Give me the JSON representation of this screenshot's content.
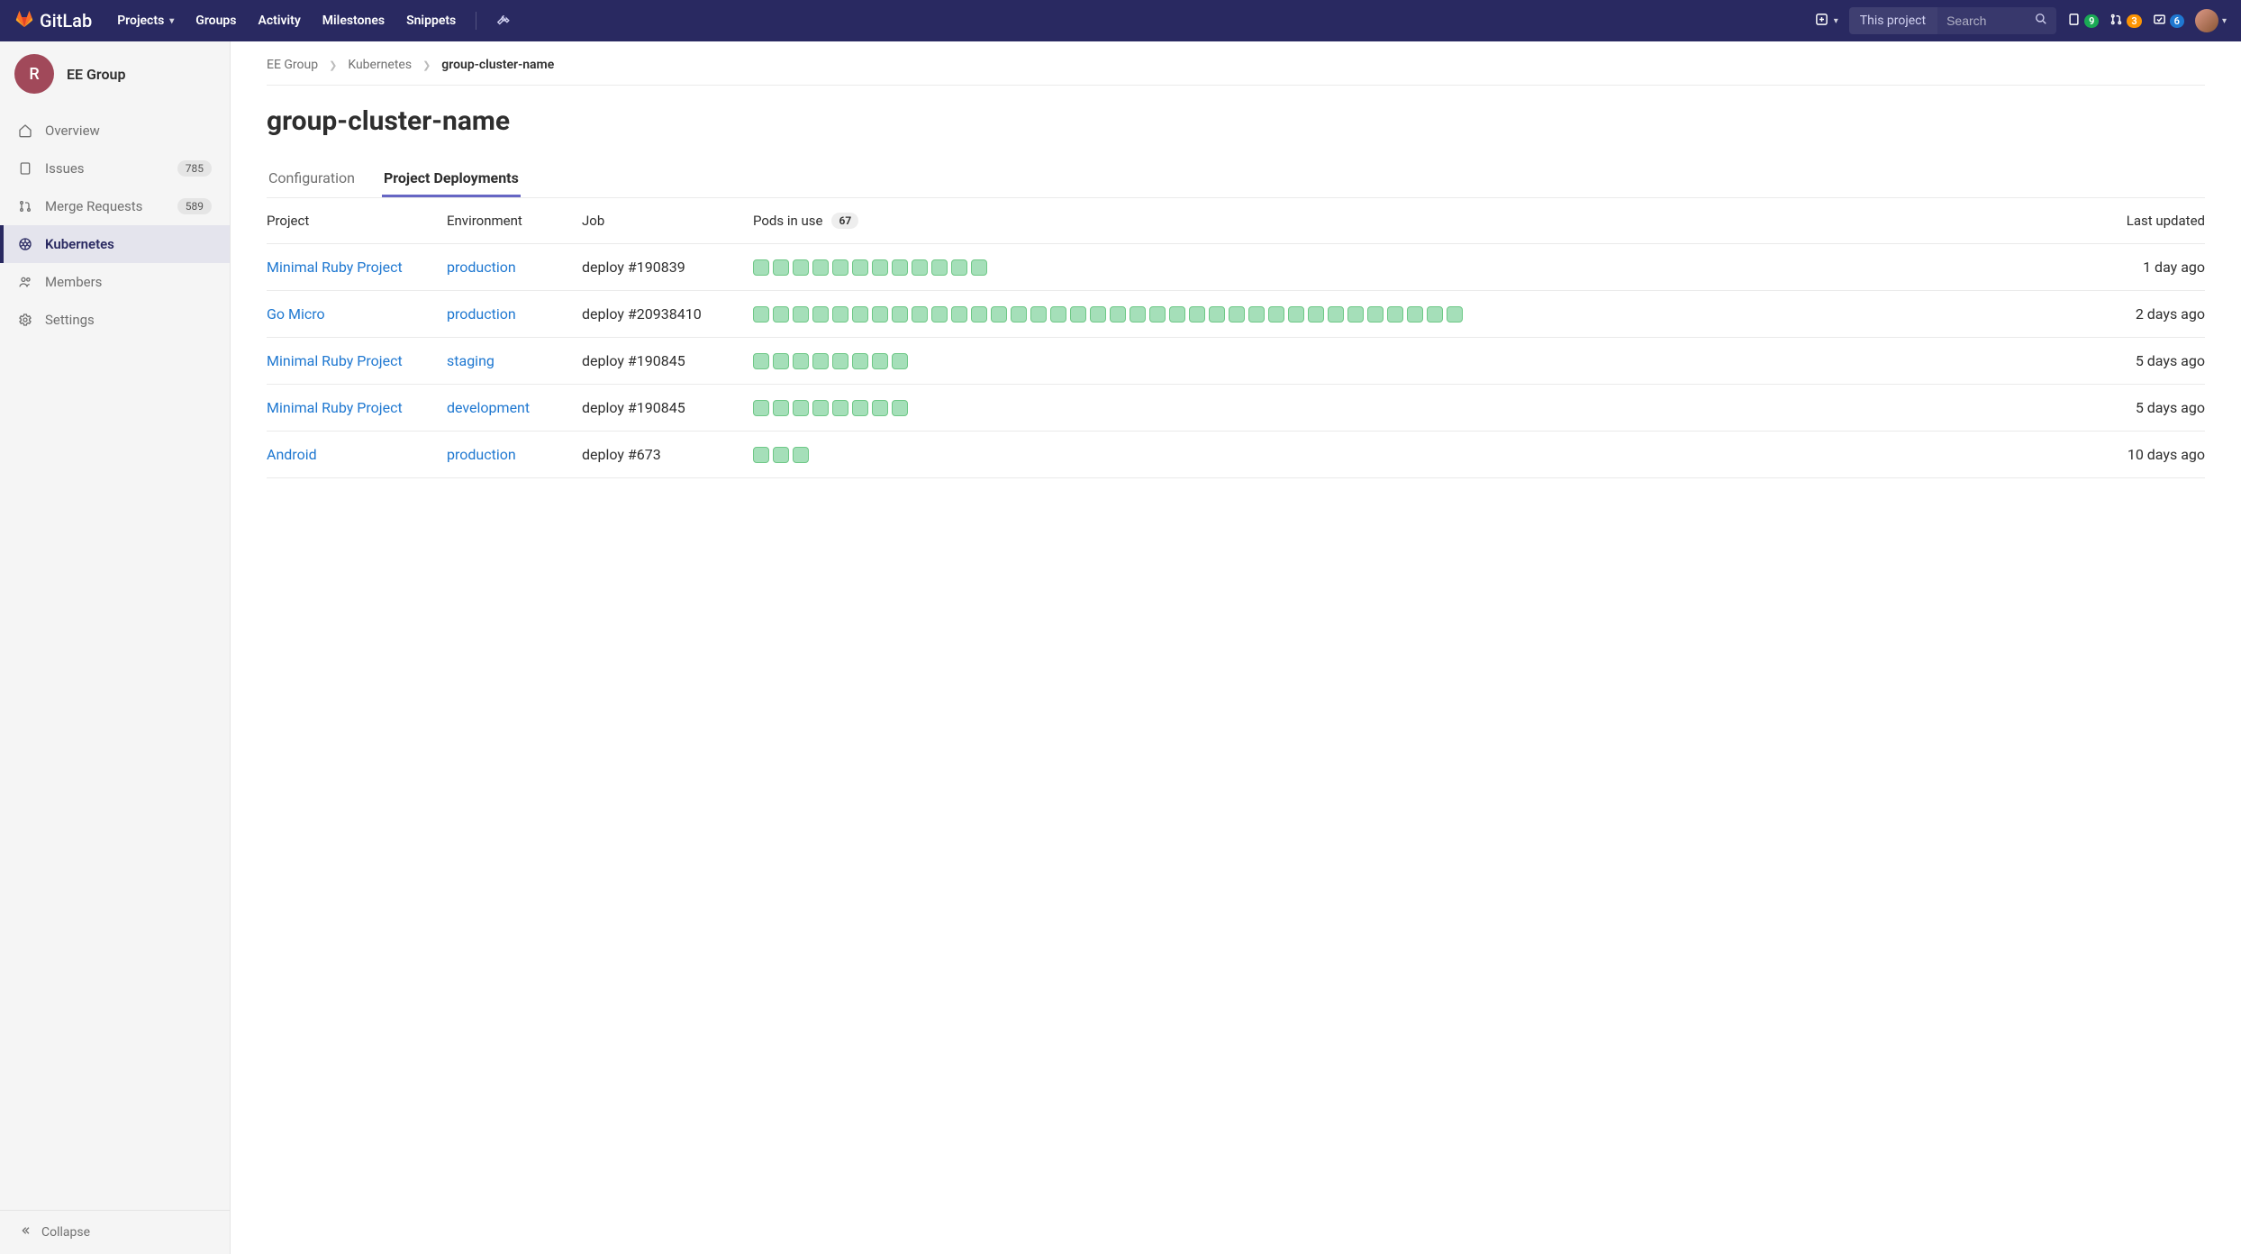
{
  "brand": "GitLab",
  "nav": {
    "projects": "Projects",
    "groups": "Groups",
    "activity": "Activity",
    "milestones": "Milestones",
    "snippets": "Snippets"
  },
  "search": {
    "scope": "This project",
    "placeholder": "Search"
  },
  "counters": {
    "issues": "9",
    "mrs": "3",
    "todos": "6"
  },
  "group": {
    "initial": "R",
    "name": "EE Group"
  },
  "sidebar": {
    "overview": "Overview",
    "issues": {
      "label": "Issues",
      "count": "785"
    },
    "merge": {
      "label": "Merge Requests",
      "count": "589"
    },
    "kubernetes": "Kubernetes",
    "members": "Members",
    "settings": "Settings",
    "collapse": "Collapse"
  },
  "crumbs": {
    "a": "EE Group",
    "b": "Kubernetes",
    "c": "group-cluster-name"
  },
  "title": "group-cluster-name",
  "tabs": {
    "config": "Configuration",
    "deploy": "Project Deployments"
  },
  "table": {
    "headers": {
      "project": "Project",
      "environment": "Environment",
      "job": "Job",
      "pods": "Pods in use",
      "updated": "Last updated"
    },
    "pods_total": "67",
    "rows": [
      {
        "project": "Minimal Ruby Project",
        "environment": "production",
        "job": "deploy #190839",
        "pods": 12,
        "updated": "1 day ago"
      },
      {
        "project": "Go Micro",
        "environment": "production",
        "job": "deploy #20938410",
        "pods": 36,
        "updated": "2 days ago"
      },
      {
        "project": "Minimal Ruby Project",
        "environment": "staging",
        "job": "deploy #190845",
        "pods": 8,
        "updated": "5 days ago"
      },
      {
        "project": "Minimal Ruby Project",
        "environment": "development",
        "job": "deploy #190845",
        "pods": 8,
        "updated": "5 days ago"
      },
      {
        "project": "Android",
        "environment": "production",
        "job": "deploy #673",
        "pods": 3,
        "updated": "10 days ago"
      }
    ]
  }
}
